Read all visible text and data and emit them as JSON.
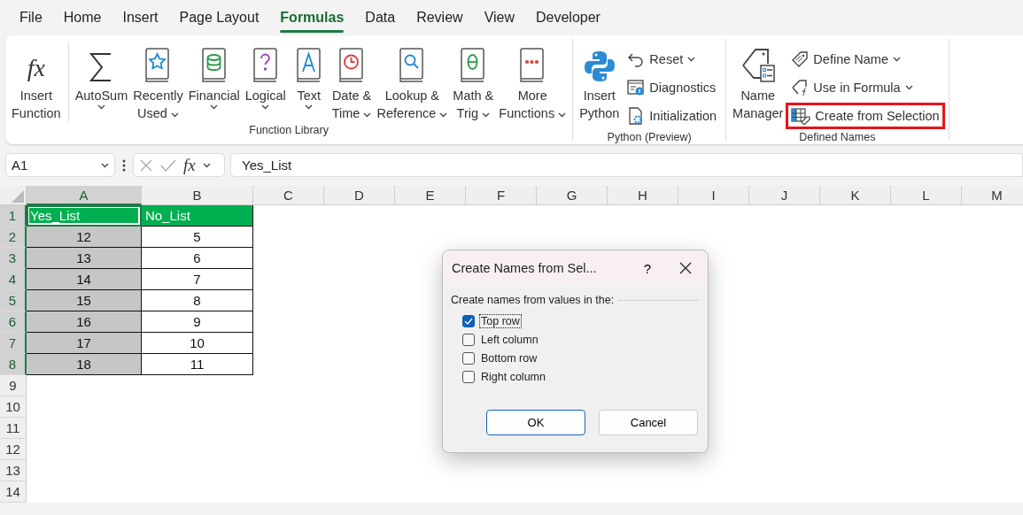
{
  "menu_tabs": [
    {
      "label": "File",
      "selected": false
    },
    {
      "label": "Home",
      "selected": false
    },
    {
      "label": "Insert",
      "selected": false
    },
    {
      "label": "Page Layout",
      "selected": false
    },
    {
      "label": "Formulas",
      "selected": true
    },
    {
      "label": "Data",
      "selected": false
    },
    {
      "label": "Review",
      "selected": false
    },
    {
      "label": "View",
      "selected": false
    },
    {
      "label": "Developer",
      "selected": false
    }
  ],
  "ribbon": {
    "groups": [
      {
        "label": "Function Library",
        "large": [
          {
            "lines": [
              "Insert",
              "Function"
            ],
            "dropdown": false,
            "glyph": "fx"
          },
          {
            "lines": [
              "AutoSum"
            ],
            "dropdown": true
          },
          {
            "lines": [
              "Recently",
              "Used"
            ],
            "dropdown": true
          },
          {
            "lines": [
              "Financial"
            ],
            "dropdown": true
          },
          {
            "lines": [
              "Logical"
            ],
            "dropdown": true
          },
          {
            "lines": [
              "Text"
            ],
            "dropdown": true
          },
          {
            "lines": [
              "Date &",
              "Time"
            ],
            "dropdown": true
          },
          {
            "lines": [
              "Lookup &",
              "Reference"
            ],
            "dropdown": true
          },
          {
            "lines": [
              "Math &",
              "Trig"
            ],
            "dropdown": true
          },
          {
            "lines": [
              "More",
              "Functions"
            ],
            "dropdown": true
          }
        ]
      },
      {
        "label": "Python (Preview)",
        "large": [
          {
            "lines": [
              "Insert",
              "Python"
            ],
            "dropdown": false
          }
        ],
        "small": [
          {
            "label": "Reset",
            "dropdown": true,
            "highlighted": false
          },
          {
            "label": "Diagnostics",
            "dropdown": false,
            "highlighted": false
          },
          {
            "label": "Initialization",
            "dropdown": false,
            "highlighted": false
          }
        ]
      },
      {
        "label": "Defined Names",
        "large": [
          {
            "lines": [
              "Name",
              "Manager"
            ],
            "dropdown": false
          }
        ],
        "small": [
          {
            "label": "Define Name",
            "dropdown": true,
            "highlighted": false
          },
          {
            "label": "Use in Formula",
            "dropdown": true,
            "highlighted": false
          },
          {
            "label": "Create from Selection",
            "dropdown": false,
            "highlighted": true
          }
        ]
      }
    ]
  },
  "formula_bar": {
    "name_box": "A1",
    "fx": "fx",
    "formula": "Yes_List"
  },
  "grid": {
    "columns": [
      {
        "label": "A",
        "selected": true
      },
      {
        "label": "B",
        "selected": false
      },
      {
        "label": "C",
        "selected": false
      },
      {
        "label": "D",
        "selected": false
      },
      {
        "label": "E",
        "selected": false
      },
      {
        "label": "F",
        "selected": false
      },
      {
        "label": "G",
        "selected": false
      },
      {
        "label": "H",
        "selected": false
      },
      {
        "label": "I",
        "selected": false
      },
      {
        "label": "J",
        "selected": false
      },
      {
        "label": "K",
        "selected": false
      },
      {
        "label": "L",
        "selected": false
      },
      {
        "label": "M",
        "selected": false
      }
    ],
    "rows": [
      {
        "number": "1",
        "selected": true,
        "kind": "header",
        "cells": [
          "Yes_List",
          "No_List"
        ]
      },
      {
        "number": "2",
        "selected": true,
        "kind": "data",
        "cells": [
          "12",
          "5"
        ]
      },
      {
        "number": "3",
        "selected": true,
        "kind": "data",
        "cells": [
          "13",
          "6"
        ]
      },
      {
        "number": "4",
        "selected": true,
        "kind": "data",
        "cells": [
          "14",
          "7"
        ]
      },
      {
        "number": "5",
        "selected": true,
        "kind": "data",
        "cells": [
          "15",
          "8"
        ]
      },
      {
        "number": "6",
        "selected": true,
        "kind": "data",
        "cells": [
          "16",
          "9"
        ]
      },
      {
        "number": "7",
        "selected": true,
        "kind": "data",
        "cells": [
          "17",
          "10"
        ]
      },
      {
        "number": "8",
        "selected": true,
        "kind": "data",
        "cells": [
          "18",
          "11"
        ]
      },
      {
        "number": "9",
        "selected": false
      },
      {
        "number": "10",
        "selected": false
      },
      {
        "number": "11",
        "selected": false
      },
      {
        "number": "12",
        "selected": false
      },
      {
        "number": "13",
        "selected": false
      },
      {
        "number": "14",
        "selected": false
      }
    ]
  },
  "dialog": {
    "title": "Create Names from Sel...",
    "help": "?",
    "section": "Create names from values in the:",
    "options": [
      {
        "label": "Top row",
        "checked": true,
        "focused": true
      },
      {
        "label": "Left column",
        "checked": false,
        "focused": false
      },
      {
        "label": "Bottom row",
        "checked": false,
        "focused": false
      },
      {
        "label": "Right column",
        "checked": false,
        "focused": false
      }
    ],
    "buttons": [
      {
        "label": "OK",
        "default": true
      },
      {
        "label": "Cancel",
        "default": false
      }
    ]
  }
}
